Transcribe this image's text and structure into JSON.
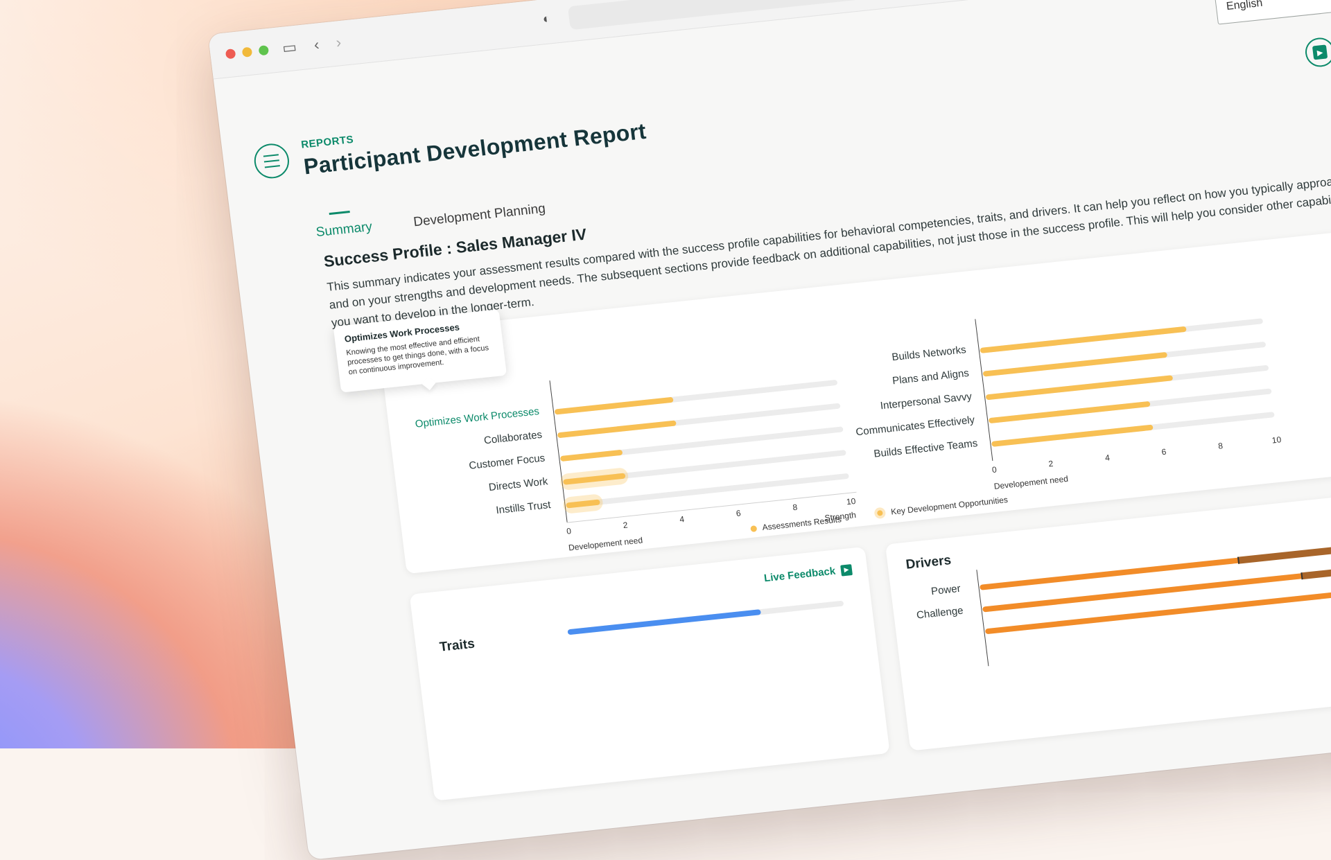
{
  "header": {
    "eyebrow": "REPORTS",
    "title": "Participant Development Report",
    "language": "English"
  },
  "tabs": [
    "Summary",
    "Development Planning"
  ],
  "summary": {
    "profile_title": "Success Profile : Sales Manager IV",
    "intro": "This summary indicates your assessment results compared with the success profile capabilities for behavioral competencies, traits, and drivers. It can help you reflect on how you typically approach work, and on your strengths and development needs. The subsequent sections provide feedback on additional capabilities, not just those in the success profile. This will help you consider other capabilities that you want to develop in the longer-term."
  },
  "live_feedback": "Live Feedback",
  "tooltip": {
    "title": "Optimizes Work Processes",
    "description": "Knowing the most effective and efficient processes to get things done, with a focus on continuous improvement."
  },
  "competencies": {
    "heading_visible": "es",
    "x_ticks": [
      "0",
      "2",
      "4",
      "6",
      "8",
      "10"
    ],
    "x_left_label": "Developement need",
    "x_right_label": "Strength",
    "legend": [
      "Assessments Results",
      "Key Development Opportunities"
    ],
    "left": [
      {
        "label": "Optimizes Work Processes",
        "value": 4.2,
        "key_dev": false
      },
      {
        "label": "Collaborates",
        "value": 4.2,
        "key_dev": false
      },
      {
        "label": "Customer Focus",
        "value": 2.2,
        "key_dev": false
      },
      {
        "label": "Directs Work",
        "value": 2.2,
        "key_dev": true
      },
      {
        "label": "Instills Trust",
        "value": 1.2,
        "key_dev": true
      }
    ],
    "right": [
      {
        "label": "Builds Networks",
        "value": 7.3
      },
      {
        "label": "Plans and Aligns",
        "value": 6.5
      },
      {
        "label": "Interpersonal Savvy",
        "value": 6.6
      },
      {
        "label": "Communicates Effectively",
        "value": 5.7
      },
      {
        "label": "Builds Effective Teams",
        "value": 5.7
      }
    ]
  },
  "traits": {
    "heading": "Traits",
    "value": 0.7,
    "color": "#4a8ef0"
  },
  "drivers": {
    "heading": "Drivers",
    "rows": [
      {
        "label": "Power",
        "value": 0.98,
        "range": [
          0.55,
          0.78
        ]
      },
      {
        "label": "Challenge",
        "value": 0.98,
        "range": [
          0.68,
          0.9
        ]
      },
      {
        "label": "",
        "value": 0.92,
        "range": [
          0.74,
          0.95
        ]
      }
    ]
  },
  "colors": {
    "brand": "#0c8a6a",
    "assessment": "#f8c054",
    "driver": "#f28c28"
  }
}
